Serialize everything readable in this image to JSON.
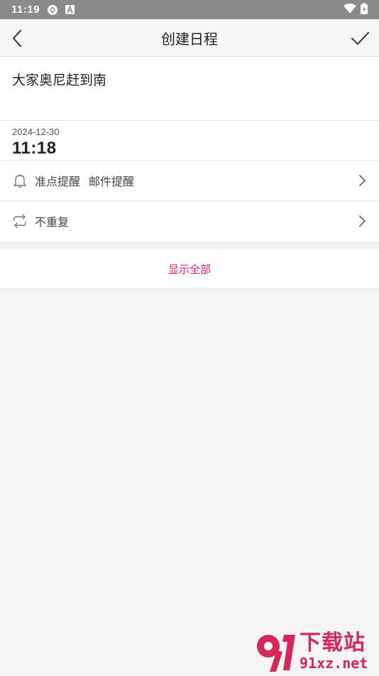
{
  "statusbar": {
    "time": "11:19",
    "icons": [
      "sync-icon",
      "a-notification-icon",
      "wifi-icon",
      "battery-icon"
    ]
  },
  "appbar": {
    "title": "创建日程",
    "back_icon": "back-arrow-icon",
    "confirm_icon": "check-icon"
  },
  "event": {
    "title_value": "大家奥尼赶到南",
    "date": "2024-12-30",
    "time": "11:18"
  },
  "reminder": {
    "icon": "bell-icon",
    "label": "准点提醒",
    "label2": "邮件提醒"
  },
  "repeat": {
    "icon": "repeat-icon",
    "label": "不重复"
  },
  "show_all": {
    "label": "显示全部",
    "color": "#e0207a"
  },
  "watermark": {
    "cn": "下载站",
    "en": "91xz.net",
    "color": "#d8265a"
  }
}
